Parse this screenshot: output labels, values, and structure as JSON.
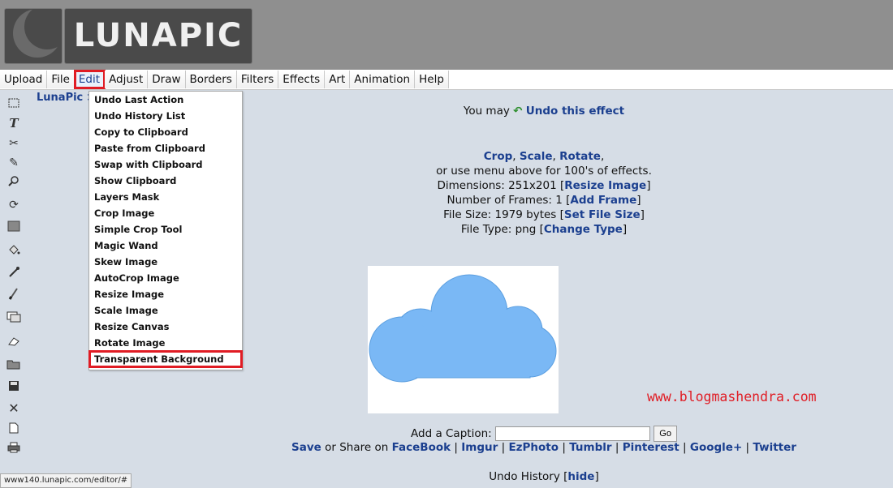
{
  "logo": {
    "text": "LUNAPIC"
  },
  "menubar": {
    "items": [
      "Upload",
      "File",
      "Edit",
      "Adjust",
      "Draw",
      "Borders",
      "Filters",
      "Effects",
      "Art",
      "Animation",
      "Help"
    ]
  },
  "breadcrumb": {
    "text": "LunaPic >"
  },
  "edit_menu": {
    "items": [
      "Undo Last Action",
      "Undo History List",
      "Copy to Clipboard",
      "Paste from Clipboard",
      "Swap with Clipboard",
      "Show Clipboard",
      "Layers Mask",
      "Crop Image",
      "Simple Crop Tool",
      "Magic Wand",
      "Skew Image",
      "AutoCrop Image",
      "Resize Image",
      "Scale Image",
      "Resize Canvas",
      "Rotate Image",
      "Transparent Background"
    ]
  },
  "info": {
    "you_may": "You may",
    "undo_effect": "Undo this effect",
    "crop": "Crop",
    "scale": "Scale",
    "rotate": "Rotate",
    "menu_hint": "or use menu above for 100's of effects.",
    "dimensions_label": "Dimensions: 251x201 [",
    "resize_image": "Resize Image",
    "frames_label": "Number of Frames: 1 [",
    "add_frame": "Add Frame",
    "filesize_label": "File Size: 1979 bytes [",
    "set_file_size": "Set File Size",
    "filetype_label": "File Type: png [",
    "change_type": "Change Type"
  },
  "caption": {
    "label": "Add a Caption:",
    "value": "",
    "go_label": "Go"
  },
  "share": {
    "save": "Save",
    "or_share": "or Share on",
    "links": [
      "FaceBook",
      "Imgur",
      "EzPhoto",
      "Tumblr",
      "Pinterest",
      "Google+",
      "Twitter"
    ]
  },
  "undo_history": {
    "label": "Undo History [",
    "hide": "hide"
  },
  "watermark": {
    "text": "www.blogmashendra.com"
  },
  "status_bar": {
    "url": "www140.lunapic.com/editor/#"
  },
  "colors": {
    "accent_red": "#e01c24",
    "link_blue": "#1b3f8f",
    "cloud": "#7ab8f5",
    "background": "#d6dde6"
  }
}
